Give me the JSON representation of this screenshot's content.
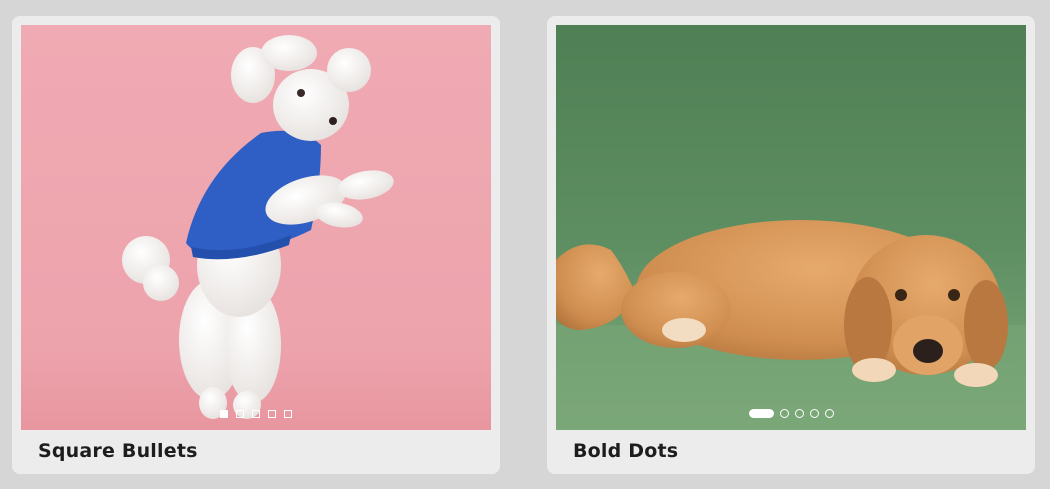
{
  "cards": [
    {
      "title": "Square Bullets",
      "image": "white-poodle-blue-sweater-photo",
      "background_color": "#eea6ae",
      "bullet_style": "square",
      "slide_count": 5,
      "active_index": 0
    },
    {
      "title": "Bold Dots",
      "image": "golden-retriever-lying-photo",
      "background_color": "#5e8b5f",
      "bullet_style": "dots",
      "slide_count": 5,
      "active_index": 0
    }
  ]
}
